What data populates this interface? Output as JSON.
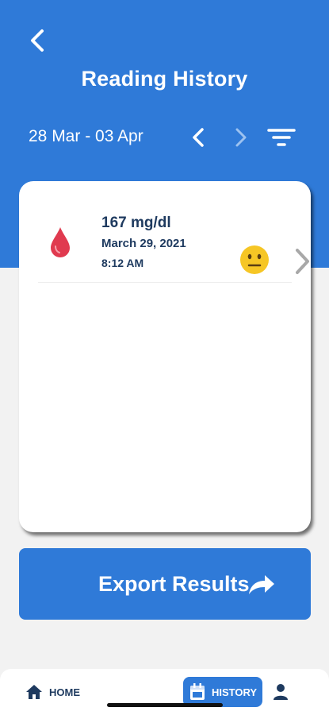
{
  "header": {
    "title": "Reading History",
    "date_range": "28 Mar - 03 Apr",
    "back_icon": "arrow-left-icon",
    "prev_icon": "chevron-left-icon",
    "next_icon": "chevron-right-icon",
    "filter_icon": "filter-icon"
  },
  "readings": [
    {
      "value": "167 mg/dl",
      "date": "March 29, 2021",
      "time": "8:12 AM",
      "icon": "blood-drop-icon",
      "mood_icon": "neutral-face-icon"
    }
  ],
  "export": {
    "label": "Export Results",
    "icon": "share-arrow-icon"
  },
  "tabbar": {
    "home_label": "HOME",
    "history_label": "HISTORY",
    "profile_icon": "user-icon"
  },
  "colors": {
    "primary": "#2f7ad8",
    "text": "#1e3a5f",
    "background": "#f2f2f2",
    "drop": "#e03a4f",
    "mood": "#f6c625"
  }
}
